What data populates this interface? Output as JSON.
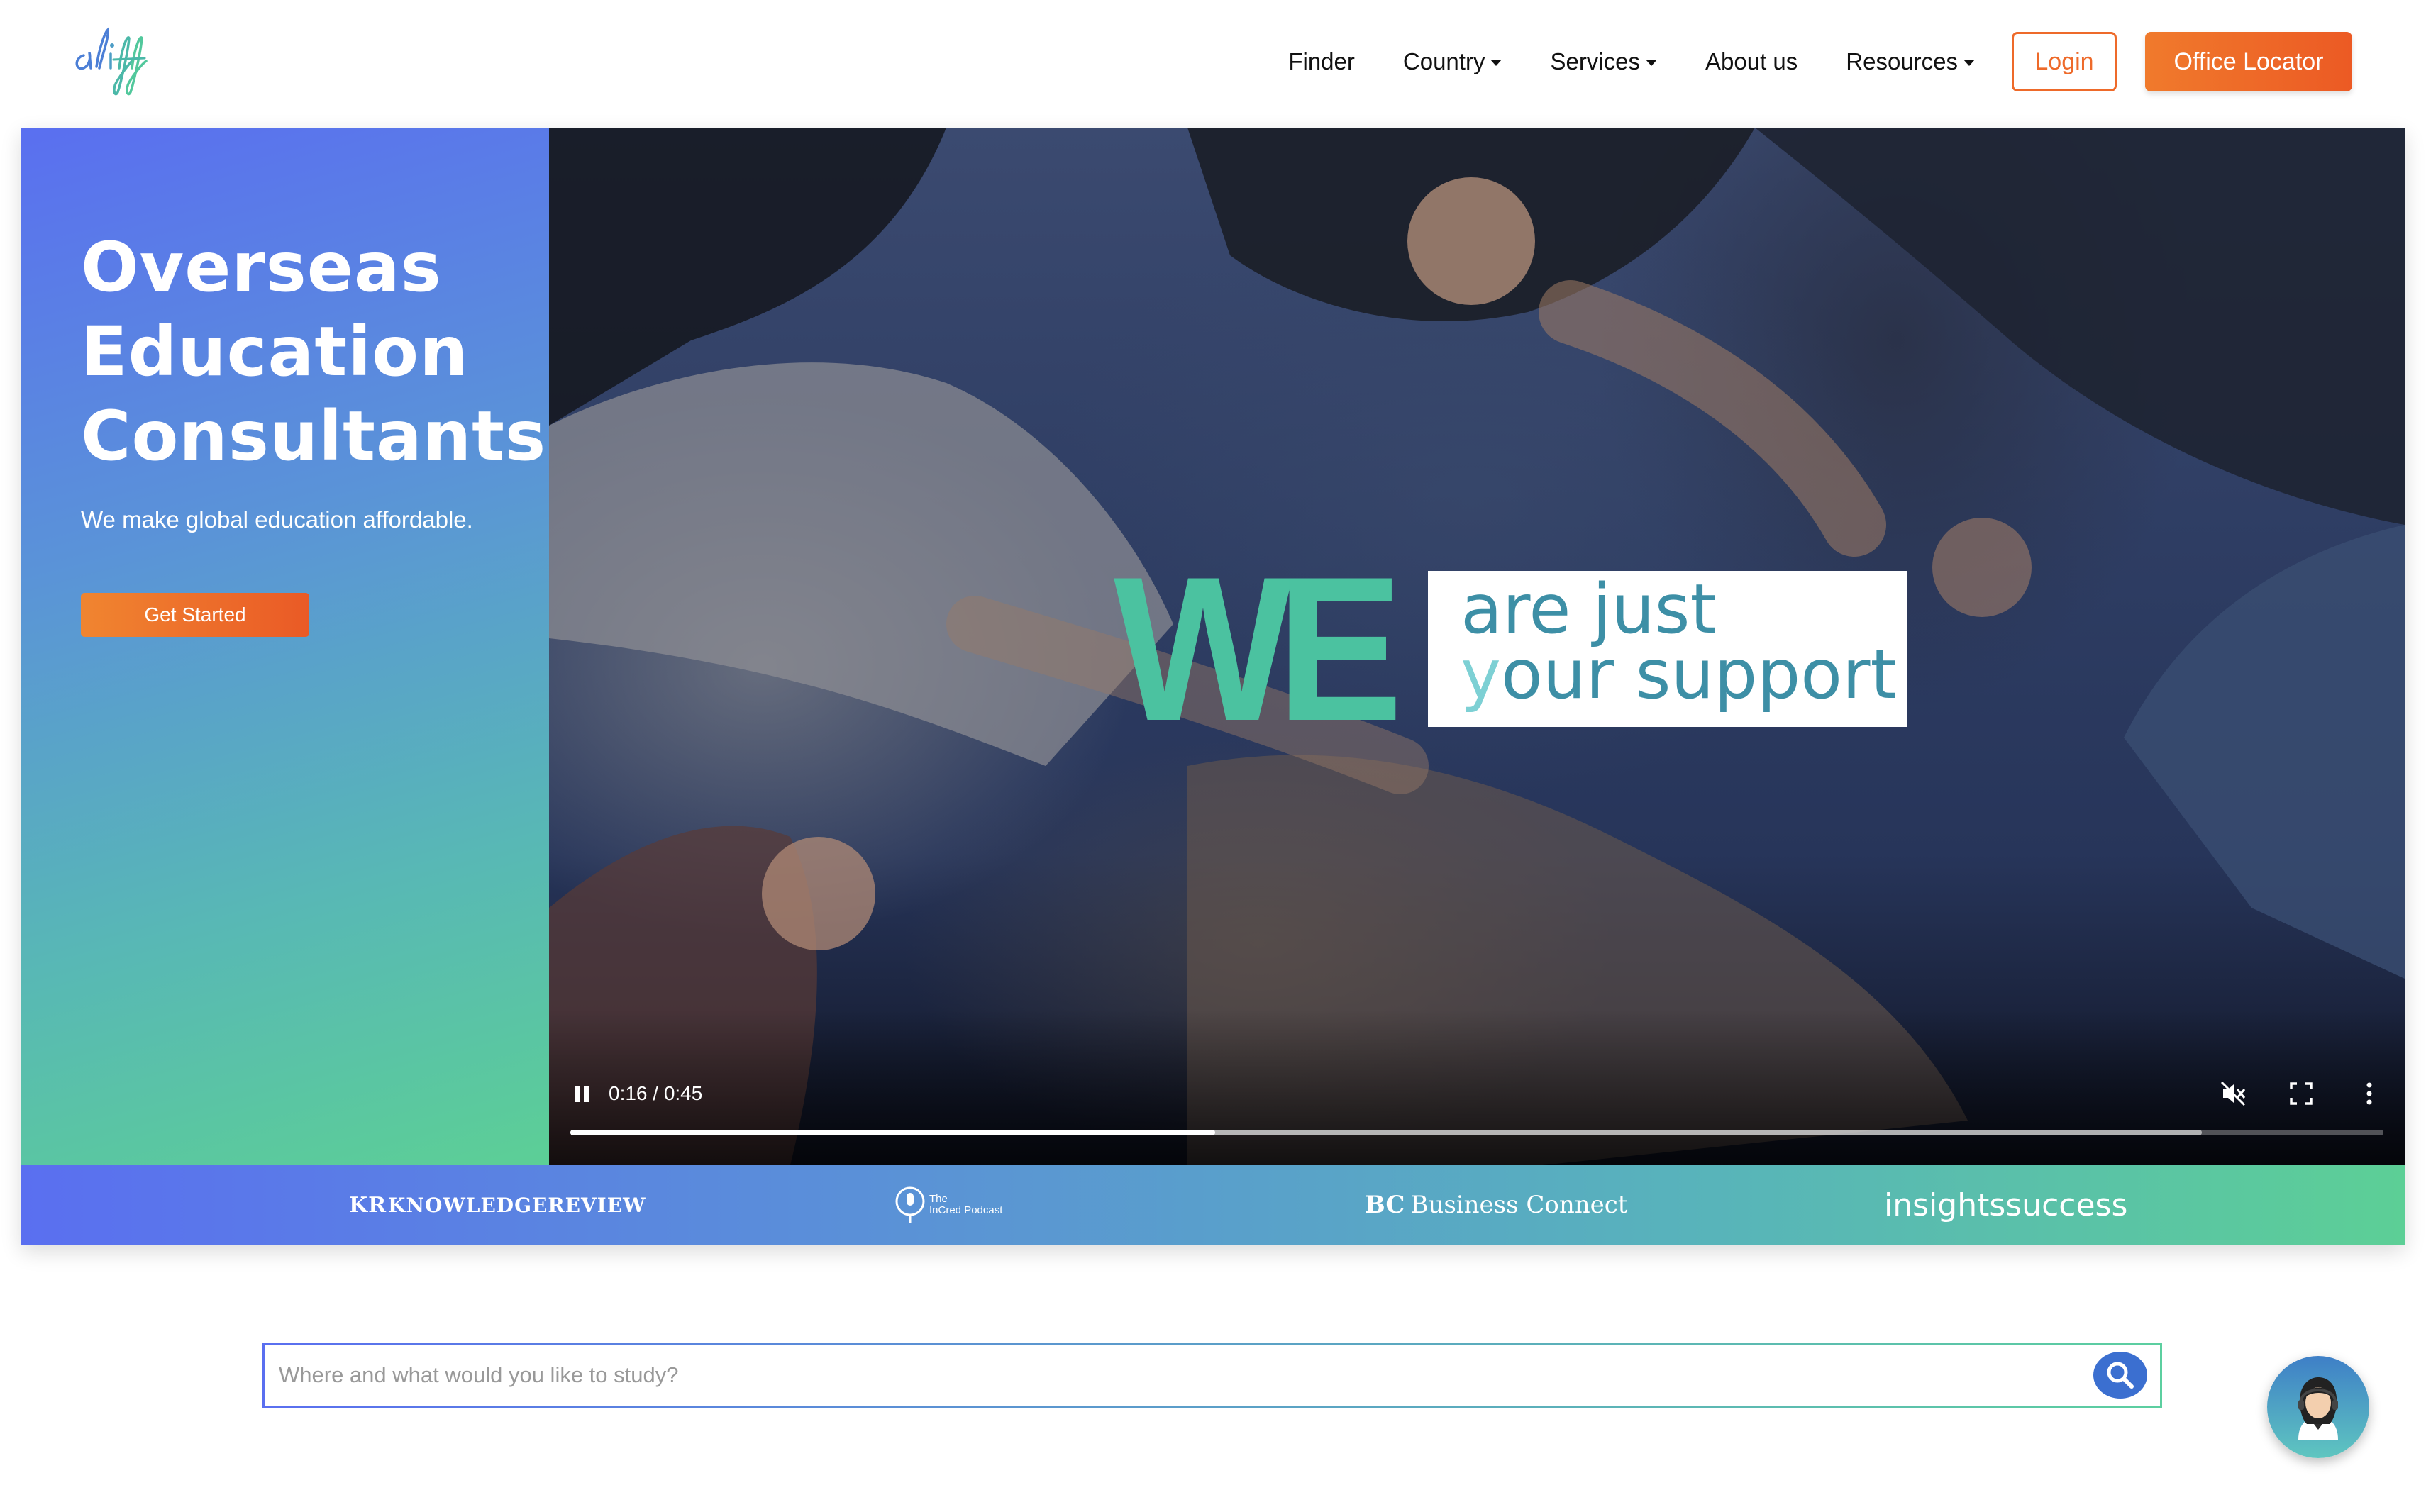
{
  "header": {
    "logo_text": "aliff",
    "nav": {
      "finder": "Finder",
      "country": "Country",
      "services": "Services",
      "about": "About us",
      "resources": "Resources"
    },
    "login_label": "Login",
    "office_locator_label": "Office Locator"
  },
  "hero": {
    "title_line1": "Overseas",
    "title_line2": "Education",
    "title_line3": "Consultants.",
    "subtitle": "We make global education affordable.",
    "cta_label": "Get Started"
  },
  "video": {
    "caption_we": "WE",
    "caption_line1": "are just",
    "caption_line2_first": "y",
    "caption_line2_rest": "our support",
    "time_display": "0:16 / 0:45",
    "progress_fraction": 0.3556,
    "buffered_fraction": 0.9,
    "play_state_icon": "pause-icon",
    "muted": true
  },
  "press": {
    "logo1": "KNOWLEDGEREVIEW",
    "logo1_mark": "KR",
    "logo2_line1": "The",
    "logo2_line2": "InCred Podcast",
    "logo3": "Business Connect",
    "logo3_mark": "BC",
    "logo4": "insightssuccess"
  },
  "search": {
    "placeholder": "Where and what would you like to study?",
    "value": ""
  },
  "colors": {
    "accent_orange": "#ee6a2a",
    "gradient_start": "#5a6ff0",
    "gradient_end": "#5ccf96",
    "caption_green": "#4bc2a0",
    "caption_teal": "#3d8fa6",
    "search_button": "#3b6fd0"
  }
}
